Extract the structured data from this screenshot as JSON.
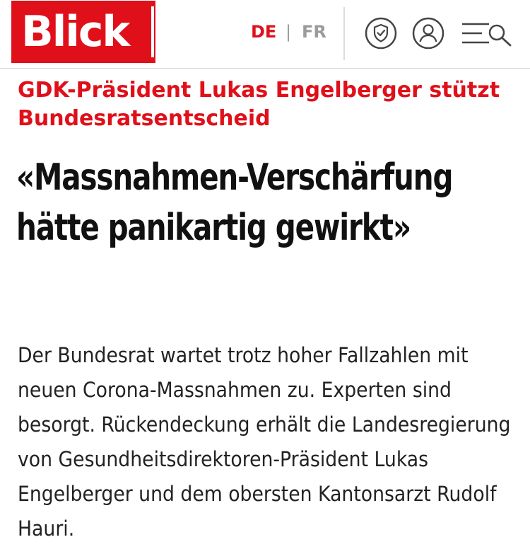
{
  "header": {
    "logo_text": "Blick",
    "brand_color": "#e0101a",
    "languages": {
      "active": "DE",
      "separator": "|",
      "inactive": "FR"
    },
    "icons": [
      "shield-check-icon",
      "user-account-icon",
      "menu-search-icon"
    ]
  },
  "article": {
    "kicker": "GDK-Präsident Lukas Engelberger stützt Bundesratsentscheid",
    "title": "«Massnahmen-Verschärfung hätte panikartig gewirkt»",
    "lead": "Der Bundesrat wartet trotz hoher Fallzahlen mit neuen Corona-Massnahmen zu. Experten sind besorgt. Rückendeckung erhält die Landesregierung von Gesundheitsdirektoren-Präsident Lukas Engelberger und dem obersten Kantonsarzt Rudolf Hauri."
  }
}
